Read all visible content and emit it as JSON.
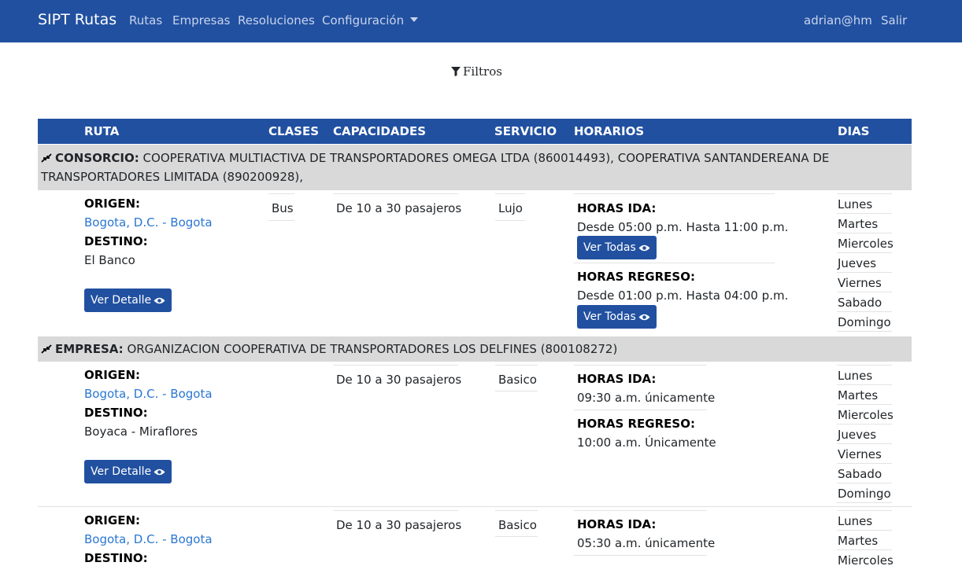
{
  "navbar": {
    "brand": "SIPT Rutas",
    "links": [
      "Rutas",
      "Empresas",
      "Resoluciones",
      "Configuración"
    ],
    "user": "adrian@hm",
    "logout": "Salir"
  },
  "filter": {
    "label": "Filtros"
  },
  "table": {
    "headers": [
      "RUTA",
      "CLASES",
      "CAPACIDADES",
      "SERVICIO",
      "HORARIOS",
      "DIAS"
    ]
  },
  "groups": [
    {
      "kind": "CONSORCIO:",
      "text": "COOPERATIVA MULTIACTIVA DE TRANSPORTADORES OMEGA LTDA (860014493), COOPERATIVA SANTANDEREANA DE TRANSPORTADORES LIMITADA (890200928),",
      "row": {
        "origin_label": "ORIGEN:",
        "origin": "Bogota, D.C. - Bogota",
        "dest_label": "DESTINO:",
        "dest": "El Banco",
        "detail_button": "Ver Detalle",
        "clase": "Bus",
        "capacidad": "De 10 a 30 pasajeros",
        "servicio": "Lujo",
        "ida_label": "HORAS IDA:",
        "ida": "Desde 05:00 p.m. Hasta 11:00 p.m.",
        "ida_button": "Ver Todas",
        "regreso_label": "HORAS REGRESO:",
        "regreso": "Desde 01:00 p.m. Hasta 04:00 p.m.",
        "regreso_button": "Ver Todas",
        "dias": [
          "Lunes",
          "Martes",
          "Miercoles",
          "Jueves",
          "Viernes",
          "Sabado",
          "Domingo"
        ]
      }
    },
    {
      "kind": "EMPRESA:",
      "text": "ORGANIZACION COOPERATIVA DE TRANSPORTADORES LOS DELFINES (800108272)",
      "rows": [
        {
          "origin_label": "ORIGEN:",
          "origin": "Bogota, D.C. - Bogota",
          "dest_label": "DESTINO:",
          "dest": "Boyaca - Miraflores",
          "detail_button": "Ver Detalle",
          "capacidad": "De 10 a 30 pasajeros",
          "servicio": "Basico",
          "ida_label": "HORAS IDA:",
          "ida": "09:30 a.m. únicamente",
          "regreso_label": "HORAS REGRESO:",
          "regreso": "10:00 a.m. Únicamente",
          "dias": [
            "Lunes",
            "Martes",
            "Miercoles",
            "Jueves",
            "Viernes",
            "Sabado",
            "Domingo"
          ]
        },
        {
          "origin_label": "ORIGEN:",
          "origin": "Bogota, D.C. - Bogota",
          "dest_label": "DESTINO:",
          "capacidad": "De 10 a 30 pasajeros",
          "servicio": "Basico",
          "ida_label": "HORAS IDA:",
          "ida": "05:30 a.m. únicamente",
          "dias": [
            "Lunes",
            "Martes",
            "Miercoles"
          ]
        }
      ]
    }
  ]
}
